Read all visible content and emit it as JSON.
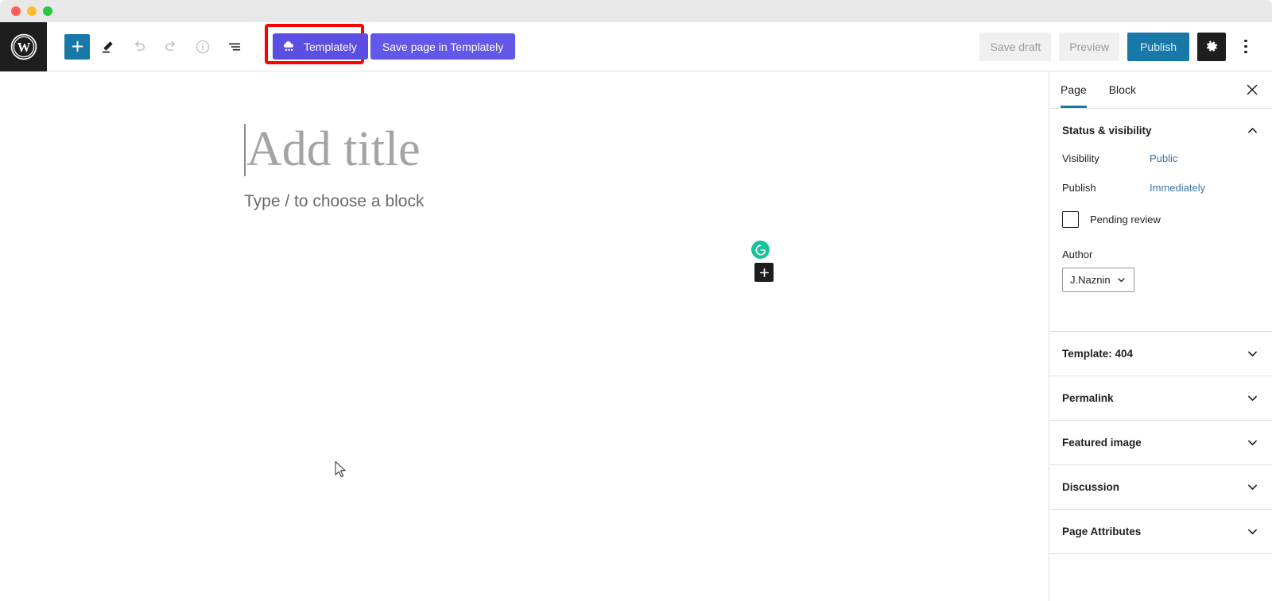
{
  "window": {
    "traffic_lights": [
      "close",
      "minimize",
      "zoom"
    ],
    "chrome_color": "#e8e8e8"
  },
  "header": {
    "logo": "wordpress-logo",
    "left_tools": [
      {
        "name": "add-block-button",
        "icon": "plus-icon",
        "label": "Add block",
        "state": "primary"
      },
      {
        "name": "tools-pencil-button",
        "icon": "pencil-icon",
        "label": "Tools",
        "state": "enabled"
      },
      {
        "name": "undo-button",
        "icon": "undo-arrow-icon",
        "label": "Undo",
        "state": "disabled"
      },
      {
        "name": "redo-button",
        "icon": "redo-arrow-icon",
        "label": "Redo",
        "state": "disabled"
      },
      {
        "name": "details-info-button",
        "icon": "info-circle-icon",
        "label": "Details",
        "state": "disabled"
      },
      {
        "name": "list-view-button",
        "icon": "list-view-icon",
        "label": "List view",
        "state": "enabled"
      }
    ],
    "templately": {
      "button_label": "Templately",
      "save_page_label": "Save page in Templately",
      "icon": "templately-cloud-icon",
      "button_color": "#5b4fe3",
      "save_button_color": "#6257e8",
      "highlight_color": "#fe0000",
      "highlighted": true
    },
    "right_tools": {
      "save_draft_label": "Save draft",
      "preview_label": "Preview",
      "publish_label": "Publish",
      "publish_color": "#1878a8",
      "settings_icon": "gear-icon",
      "settings_active": true,
      "more_options_icon": "vertical-ellipsis-icon"
    }
  },
  "canvas": {
    "title_placeholder": "Add title",
    "title_value": "",
    "block_placeholder": "Type / to choose a block",
    "grammarly_icon": "grammarly-g-icon",
    "grammarly_color": "#15c39a",
    "inserter_icon": "plus-icon",
    "cursor_icon": "arrow-cursor"
  },
  "sidebar": {
    "tabs": [
      {
        "label": "Page",
        "active": true
      },
      {
        "label": "Block",
        "active": false
      }
    ],
    "close_icon": "close-x-icon",
    "active_underline_color": "#1878a8",
    "status_visibility": {
      "title": "Status & visibility",
      "expanded": true,
      "collapse_icon": "chevron-up-icon",
      "visibility_label": "Visibility",
      "visibility_value": "Public",
      "publish_label": "Publish",
      "publish_value": "Immediately",
      "pending_review_label": "Pending review",
      "pending_review_checked": false,
      "author_label": "Author",
      "author_value": "J.Naznin",
      "author_chevron": "chevron-down-icon"
    },
    "panels": [
      {
        "title": "Template: 404",
        "expanded": false,
        "icon": "chevron-down-icon"
      },
      {
        "title": "Permalink",
        "expanded": false,
        "icon": "chevron-down-icon"
      },
      {
        "title": "Featured image",
        "expanded": false,
        "icon": "chevron-down-icon"
      },
      {
        "title": "Discussion",
        "expanded": false,
        "icon": "chevron-down-icon"
      },
      {
        "title": "Page Attributes",
        "expanded": false,
        "icon": "chevron-down-icon"
      }
    ]
  }
}
